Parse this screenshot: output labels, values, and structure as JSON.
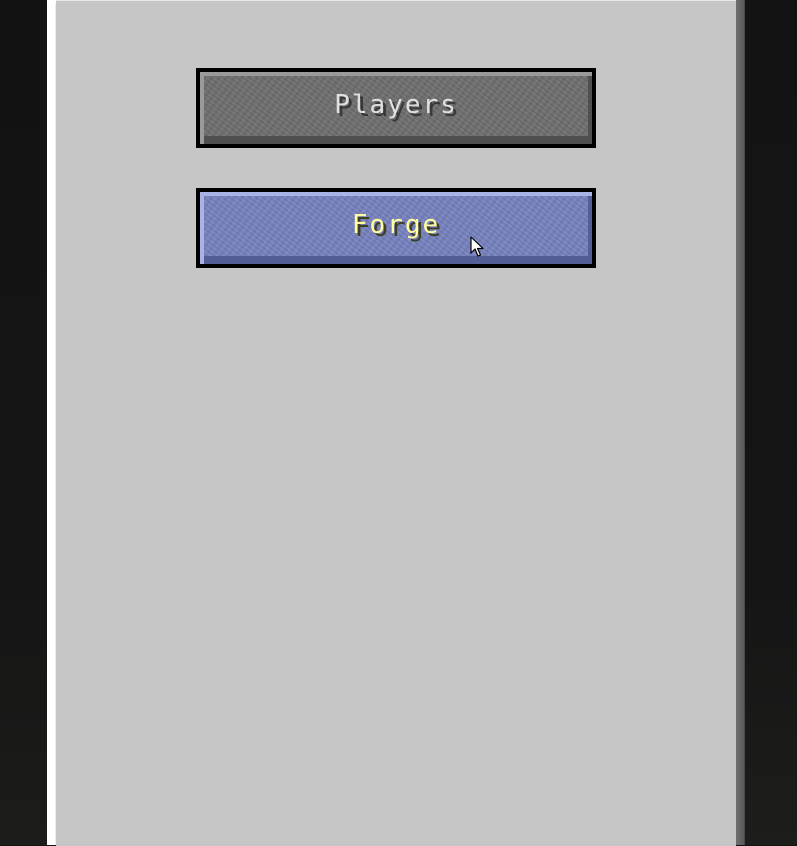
{
  "menu": {
    "buttons": [
      {
        "label": "Players",
        "state": "normal",
        "text_color": "#e0e0e0",
        "face_color": "#6e6e6e"
      },
      {
        "label": "Forge",
        "state": "hovered",
        "text_color": "#ffffa0",
        "face_color": "#7681be"
      }
    ]
  },
  "cursor": {
    "icon": "mouse-pointer-icon"
  }
}
